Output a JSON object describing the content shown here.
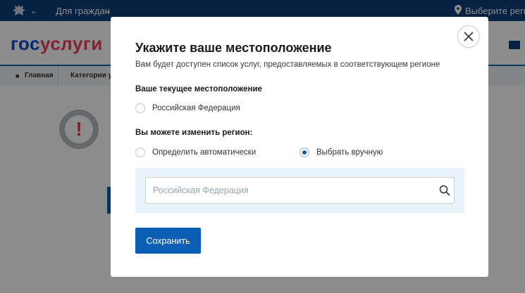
{
  "topbar": {
    "emblem_icon": "coat-of-arms-icon",
    "for_citizens": "Для граждан",
    "region_link": "Выберите регион",
    "bg_color": "#0b3e7a"
  },
  "header": {
    "logo_part1": "гос",
    "logo_part2": "услуги",
    "logo_color1": "#0d4cd3",
    "logo_color2": "#ee3f58"
  },
  "breadcrumbs": {
    "home": "Главная",
    "category": "Категории усл"
  },
  "background": {
    "warning_glyph": "!"
  },
  "modal": {
    "title": "Укажите ваше местоположение",
    "subtitle": "Вам будет доступен список услуг, предоставляемых в соответствующем регионе",
    "current_label": "Ваше текущее местоположение",
    "current_value": "Российская Федерация",
    "change_label": "Вы можете изменить регион:",
    "option_auto": "Определить автоматически",
    "option_manual": "Выбрать вручную",
    "selected_option": "manual",
    "search_placeholder": "Российская Федерация",
    "save_label": "Сохранить",
    "accent_color": "#0b5eb4"
  }
}
